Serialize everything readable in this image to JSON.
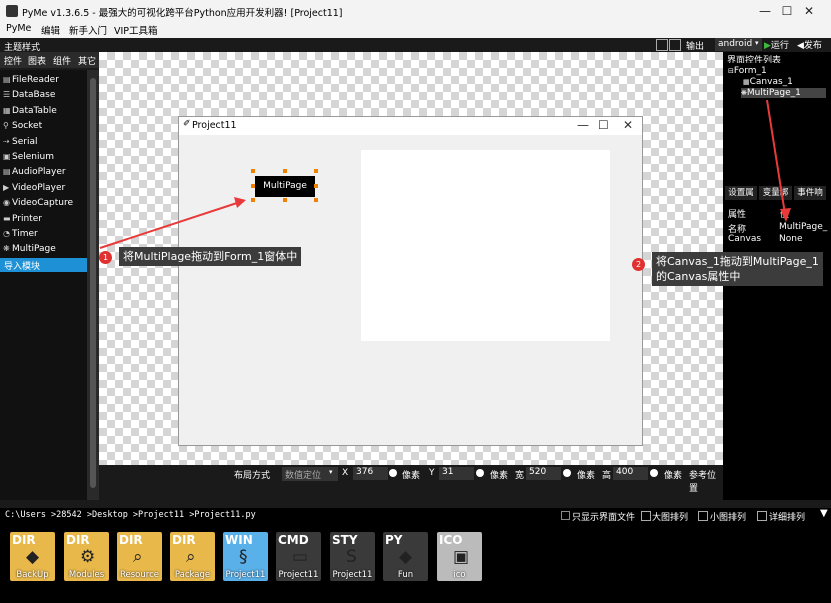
{
  "window": {
    "title": "PyMe v1.3.6.5 -  最强大的可视化跨平台Python应用开发利器!    [Project11]",
    "controls": {
      "minimize": "—",
      "maximize": "☐",
      "close": "✕"
    }
  },
  "menu": [
    "PyMe",
    "编辑",
    "新手入门",
    "VIP工具箱"
  ],
  "toolbar": {
    "theme_label": "主题样式",
    "output": "输出",
    "platform": "android",
    "run": "运行",
    "publish": "发布"
  },
  "left_tabs": [
    "控件",
    "图表",
    "组件",
    "其它"
  ],
  "left_items": [
    {
      "label": "FileReader",
      "icon": "file-icon",
      "glyph": "▤"
    },
    {
      "label": "DataBase",
      "icon": "database-icon",
      "glyph": "☰"
    },
    {
      "label": "DataTable",
      "icon": "table-icon",
      "glyph": "▦"
    },
    {
      "label": "Socket",
      "icon": "socket-icon",
      "glyph": "⚲"
    },
    {
      "label": "Serial",
      "icon": "serial-icon",
      "glyph": "⇢"
    },
    {
      "label": "Selenium",
      "icon": "selenium-icon",
      "glyph": "▣"
    },
    {
      "label": "AudioPlayer",
      "icon": "audio-icon",
      "glyph": "▤"
    },
    {
      "label": "VideoPlayer",
      "icon": "video-icon",
      "glyph": "▶"
    },
    {
      "label": "VideoCapture",
      "icon": "capture-icon",
      "glyph": "◉"
    },
    {
      "label": "Printer",
      "icon": "printer-icon",
      "glyph": "▬"
    },
    {
      "label": "Timer",
      "icon": "timer-icon",
      "glyph": "◔"
    },
    {
      "label": "MultiPage",
      "icon": "multipage-icon",
      "glyph": "❋"
    }
  ],
  "import_module": "导入模块",
  "form": {
    "title": "Project11",
    "multipage_label": "MultiPage"
  },
  "layout_bar": {
    "layout_label": "布局方式",
    "layout_value": "数值定位",
    "x_label": "X",
    "x_value": "376",
    "x_unit": "像素",
    "y_label": "Y",
    "y_value": "31",
    "y_unit": "像素",
    "w_label": "宽",
    "w_value": "520",
    "w_unit": "像素",
    "h_label": "高",
    "h_value": "400",
    "h_unit": "像素",
    "ref_label": "参考位置"
  },
  "right_panel": {
    "tree_title": "界面控件列表",
    "tree_items": [
      "Form_1",
      "Canvas_1",
      "MultiPage_1"
    ],
    "tabs": [
      "设置属",
      "变量绑",
      "事件响"
    ],
    "prop_header": "属性",
    "value_header": "值",
    "props": [
      {
        "name": "名称",
        "value": "MultiPage_"
      },
      {
        "name": "Canvas",
        "value": "None"
      }
    ]
  },
  "annotations": [
    {
      "num": "1",
      "text": "将MultiPlage拖动到Form_1窗体中"
    },
    {
      "num": "2",
      "line1": "将Canvas_1拖动到MultiPage_1",
      "line2": "的Canvas属性中"
    }
  ],
  "path_bar": {
    "path": "C:\\Users >28542 >Desktop >Project11 >Project11.py",
    "only_ui": "只显示界面文件",
    "large": "大图排列",
    "small": "小图排列",
    "detail": "详细排列"
  },
  "files": [
    {
      "top": "DIR",
      "label": "BackUp"
    },
    {
      "top": "DIR",
      "label": "Modules"
    },
    {
      "top": "DIR",
      "label": "Resource"
    },
    {
      "top": "DIR",
      "label": "Package"
    },
    {
      "top": "WIN",
      "label": "Project11"
    },
    {
      "top": "CMD",
      "label": "Project11"
    },
    {
      "top": "STY",
      "label": "Project11"
    },
    {
      "top": "PY",
      "label": "Fun"
    },
    {
      "top": "ICO",
      "label": "ico"
    }
  ],
  "colors": {
    "accent": "#1e90d6",
    "annotation_red": "#e03030",
    "handle": "#f08000",
    "folder": "#e8b84a"
  }
}
